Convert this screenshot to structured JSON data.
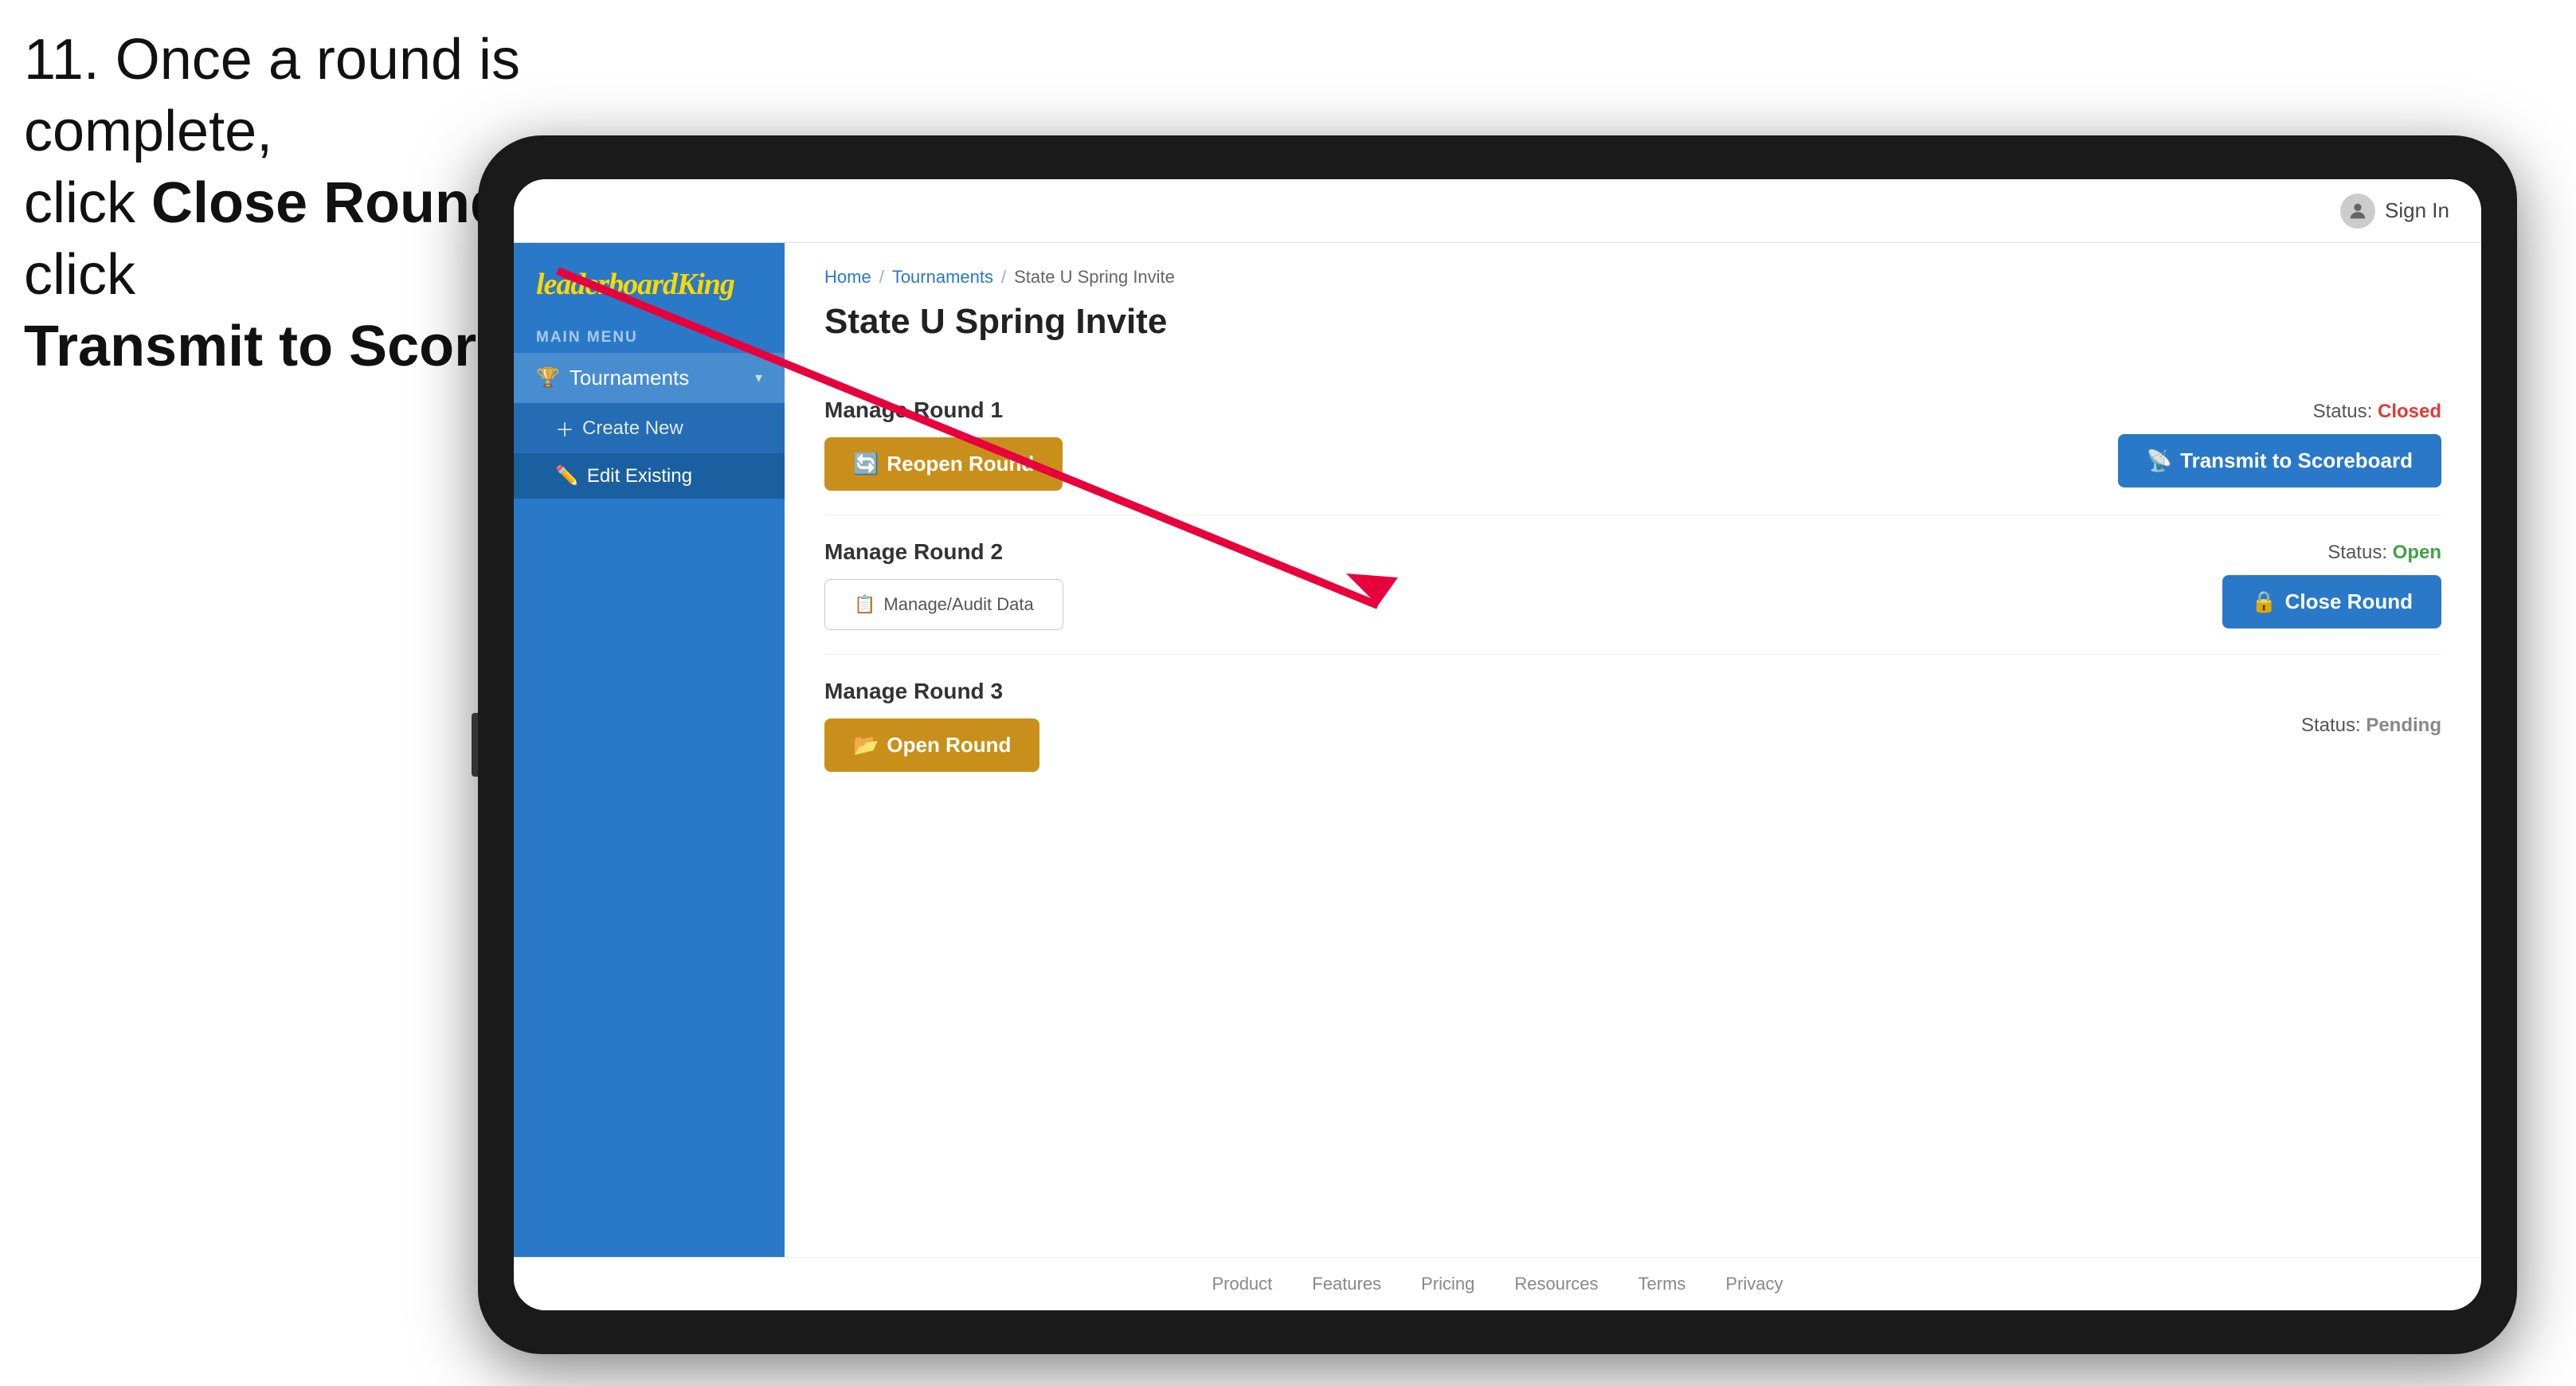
{
  "instruction": {
    "line1": "11. Once a round is complete,",
    "line2": "click ",
    "bold1": "Close Round",
    "line3": " then click",
    "bold2": "Transmit to Scoreboard."
  },
  "header": {
    "sign_in": "Sign In",
    "avatar": "👤"
  },
  "logo": {
    "text_regular": "leaderboard",
    "text_styled": "King"
  },
  "sidebar": {
    "main_menu_label": "MAIN MENU",
    "tournaments_label": "Tournaments",
    "create_new_label": "Create New",
    "edit_existing_label": "Edit Existing"
  },
  "breadcrumb": {
    "home": "Home",
    "sep1": "/",
    "tournaments": "Tournaments",
    "sep2": "/",
    "current": "State U Spring Invite"
  },
  "page": {
    "title": "State U Spring Invite"
  },
  "rounds": [
    {
      "title": "Manage Round 1",
      "status_label": "Status:",
      "status_value": "Closed",
      "status_class": "closed",
      "buttons": [
        {
          "label": "Reopen Round",
          "style": "gold",
          "icon": "🔄"
        },
        {
          "label": "Transmit to Scoreboard",
          "style": "blue",
          "icon": "📡"
        }
      ]
    },
    {
      "title": "Manage Round 2",
      "status_label": "Status:",
      "status_value": "Open",
      "status_class": "open",
      "buttons": [
        {
          "label": "Manage/Audit Data",
          "style": "gray",
          "icon": "📋"
        },
        {
          "label": "Close Round",
          "style": "blue",
          "icon": "🔒"
        }
      ]
    },
    {
      "title": "Manage Round 3",
      "status_label": "Status:",
      "status_value": "Pending",
      "status_class": "pending",
      "buttons": [
        {
          "label": "Open Round",
          "style": "gold",
          "icon": "📂"
        }
      ]
    }
  ],
  "footer": {
    "links": [
      "Product",
      "Features",
      "Pricing",
      "Resources",
      "Terms",
      "Privacy"
    ]
  },
  "colors": {
    "blue": "#2979c8",
    "gold": "#c8901a",
    "closed_red": "#e53935",
    "open_green": "#43a047"
  }
}
